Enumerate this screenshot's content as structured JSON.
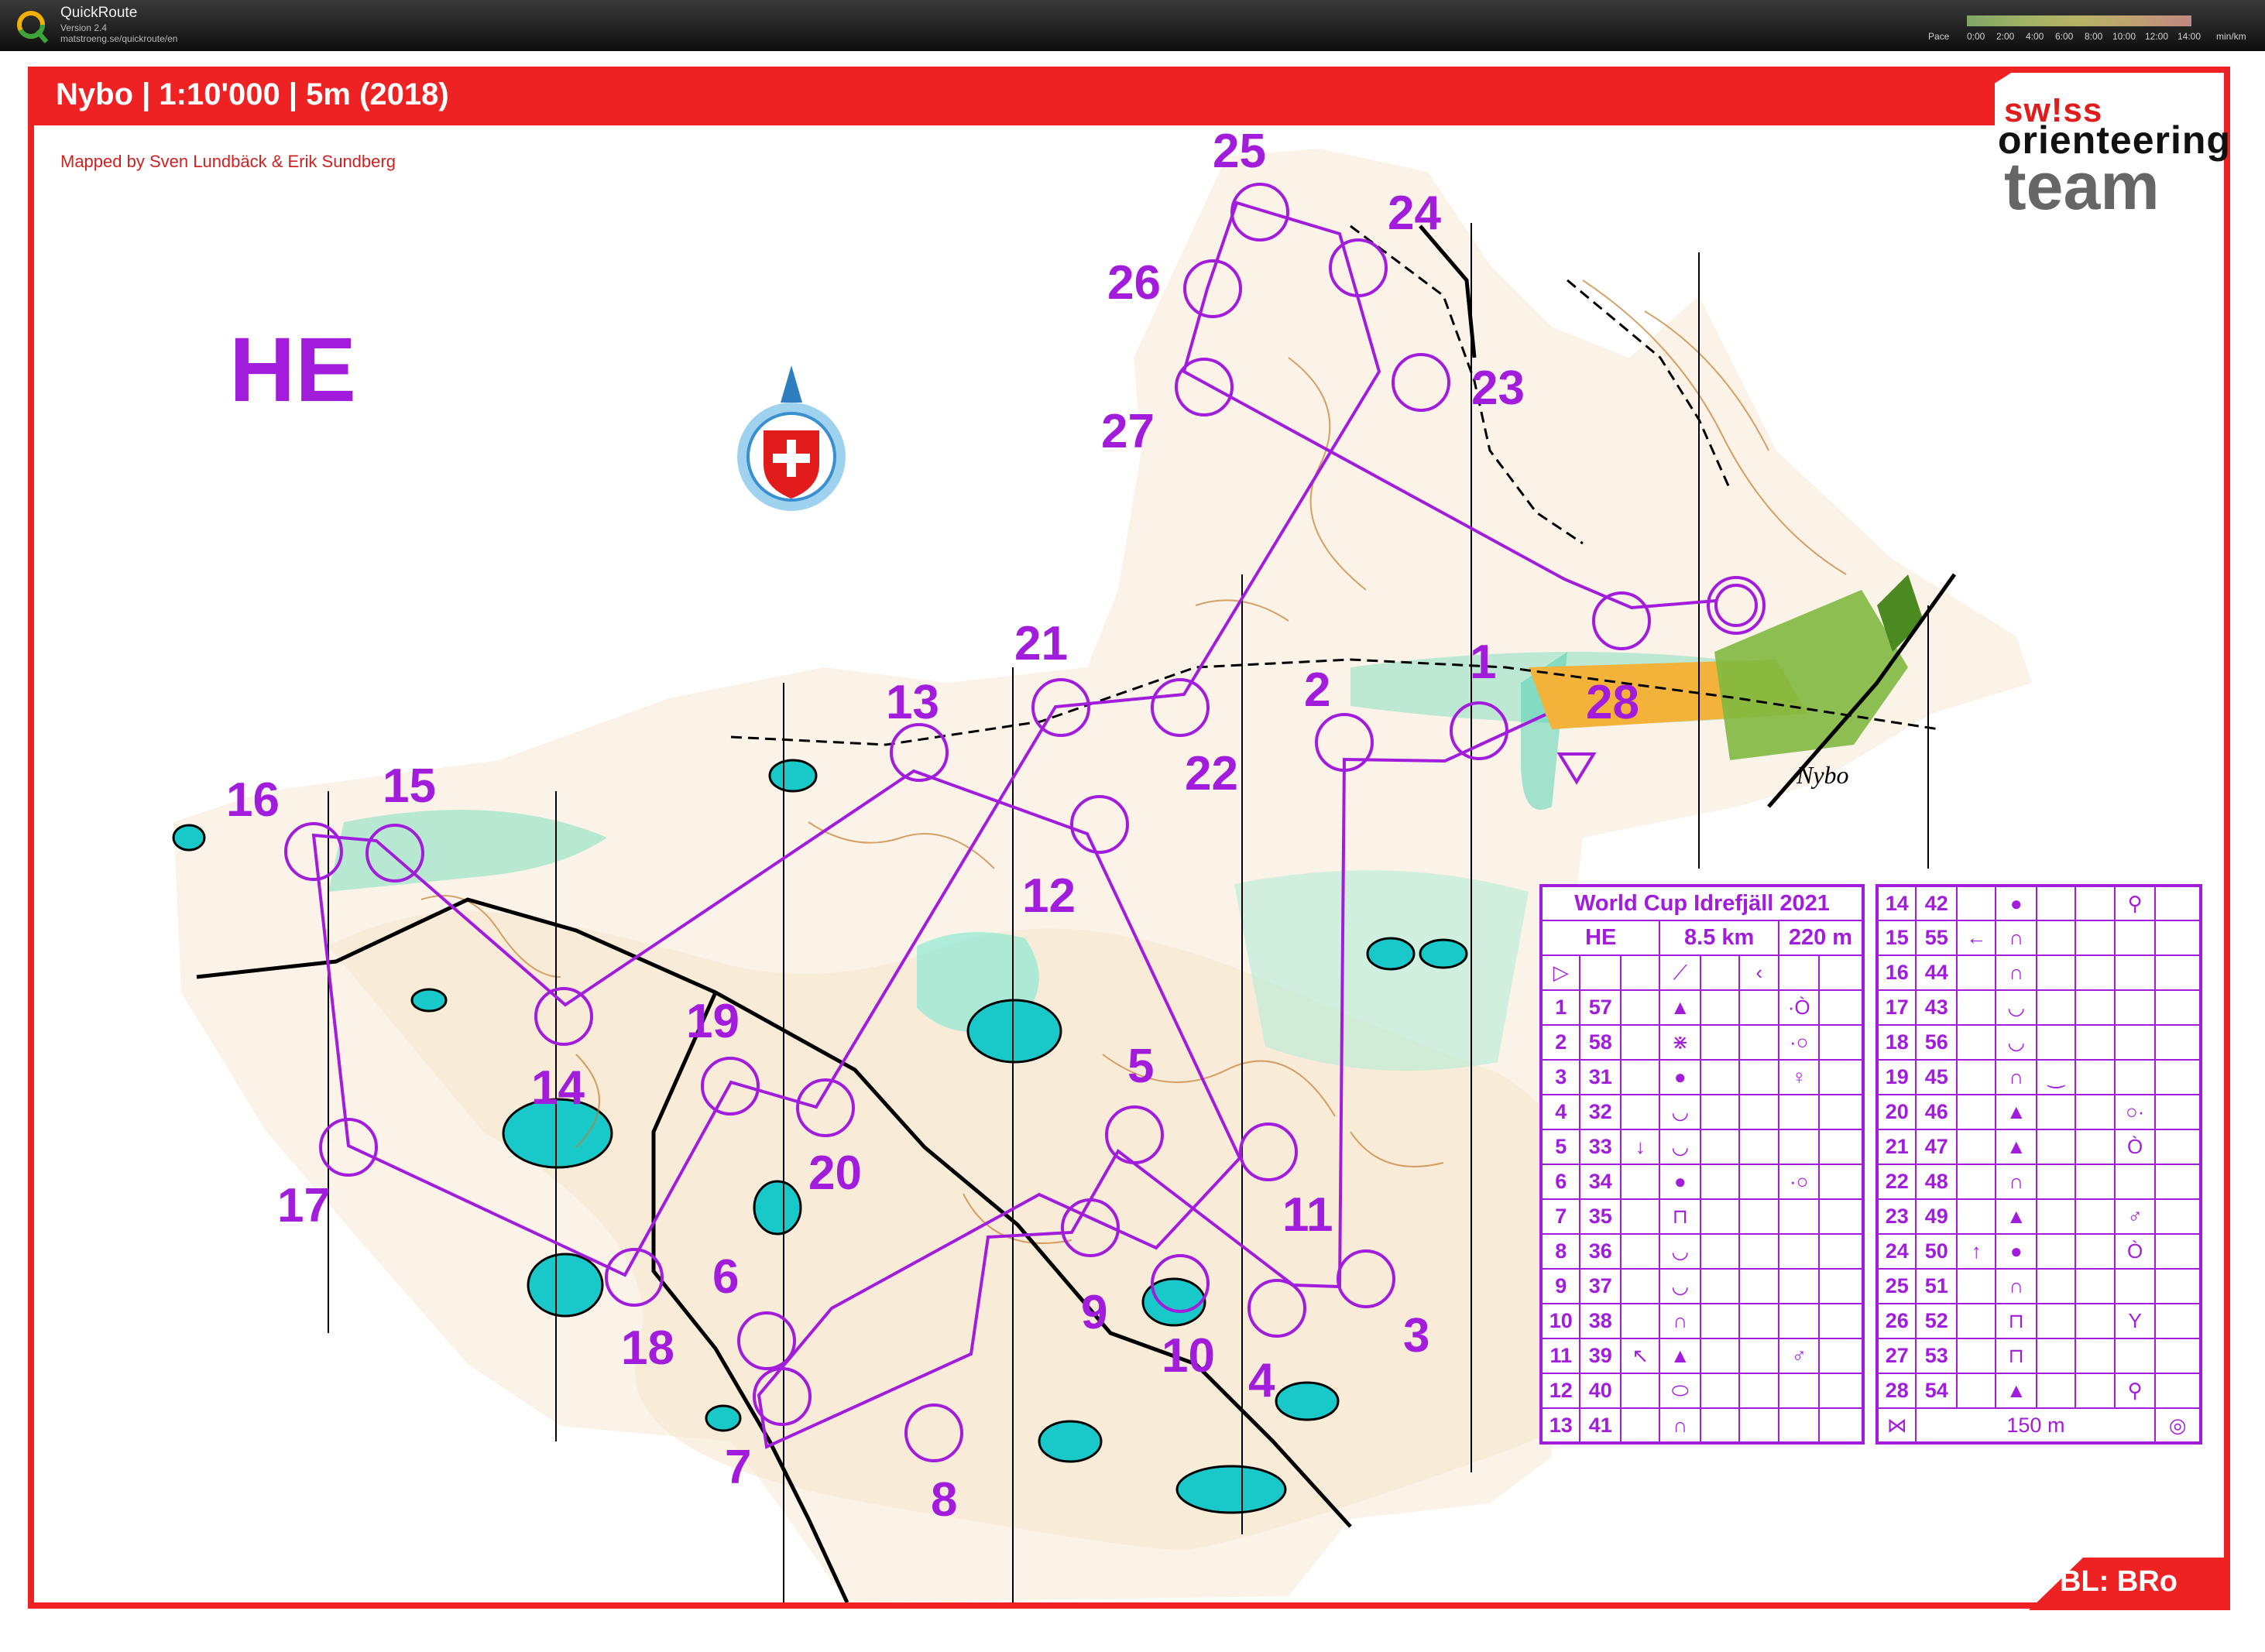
{
  "app": {
    "name": "QuickRoute",
    "version": "Version 2.4",
    "url": "matstroeng.se/quickroute/en",
    "pace_label": "Pace",
    "pace_ticks": [
      "0:00",
      "2:00",
      "4:00",
      "6:00",
      "8:00",
      "10:00",
      "12:00",
      "14:00"
    ],
    "pace_unit": "min/km"
  },
  "map": {
    "title": "Nybo | 1:10'000 | 5m (2018)",
    "mapper": "Mapped by Sven Lundbäck & Erik Sundberg",
    "class": "HE",
    "brand": [
      "sw!ss",
      "orienteering",
      "team"
    ],
    "bl": "BL: BRo",
    "place_label": "Nybo",
    "course_color": "#a21ddb",
    "frame_color": "#ee2222"
  },
  "controls": [
    {
      "num": "1"
    },
    {
      "num": "2"
    },
    {
      "num": "3"
    },
    {
      "num": "4"
    },
    {
      "num": "5"
    },
    {
      "num": "6"
    },
    {
      "num": "7"
    },
    {
      "num": "8"
    },
    {
      "num": "9"
    },
    {
      "num": "10"
    },
    {
      "num": "11"
    },
    {
      "num": "12"
    },
    {
      "num": "13"
    },
    {
      "num": "14"
    },
    {
      "num": "15"
    },
    {
      "num": "16"
    },
    {
      "num": "17"
    },
    {
      "num": "18"
    },
    {
      "num": "19"
    },
    {
      "num": "20"
    },
    {
      "num": "21"
    },
    {
      "num": "22"
    },
    {
      "num": "23"
    },
    {
      "num": "24"
    },
    {
      "num": "25"
    },
    {
      "num": "26"
    },
    {
      "num": "27"
    },
    {
      "num": "28"
    }
  ],
  "description": {
    "event": "World Cup Idrefjäll 2021",
    "class": "HE",
    "length": "8.5 km",
    "climb": "220 m",
    "finish_distance": "150 m",
    "rows": [
      {
        "n": "1",
        "code": "57",
        "dir": "",
        "feat": "▲",
        "detail": "",
        "pos": "·Ò"
      },
      {
        "n": "2",
        "code": "58",
        "dir": "",
        "feat": "⋇",
        "detail": "",
        "pos": "·○"
      },
      {
        "n": "3",
        "code": "31",
        "dir": "",
        "feat": "●",
        "detail": "",
        "pos": "♀"
      },
      {
        "n": "4",
        "code": "32",
        "dir": "",
        "feat": "◡",
        "detail": "",
        "pos": ""
      },
      {
        "n": "5",
        "code": "33",
        "dir": "↓",
        "feat": "◡",
        "detail": "",
        "pos": ""
      },
      {
        "n": "6",
        "code": "34",
        "dir": "",
        "feat": "●",
        "detail": "",
        "pos": "·○"
      },
      {
        "n": "7",
        "code": "35",
        "dir": "",
        "feat": "⊓",
        "detail": "",
        "pos": ""
      },
      {
        "n": "8",
        "code": "36",
        "dir": "",
        "feat": "◡",
        "detail": "",
        "pos": ""
      },
      {
        "n": "9",
        "code": "37",
        "dir": "",
        "feat": "◡",
        "detail": "",
        "pos": ""
      },
      {
        "n": "10",
        "code": "38",
        "dir": "",
        "feat": "∩",
        "detail": "",
        "pos": ""
      },
      {
        "n": "11",
        "code": "39",
        "dir": "↖",
        "feat": "▲",
        "detail": "",
        "pos": "♂"
      },
      {
        "n": "12",
        "code": "40",
        "dir": "",
        "feat": "⬭",
        "detail": "",
        "pos": ""
      },
      {
        "n": "13",
        "code": "41",
        "dir": "",
        "feat": "∩",
        "detail": "",
        "pos": ""
      },
      {
        "n": "14",
        "code": "42",
        "dir": "",
        "feat": "●",
        "detail": "",
        "pos": "⚲"
      },
      {
        "n": "15",
        "code": "55",
        "dir": "←",
        "feat": "∩",
        "detail": "",
        "pos": ""
      },
      {
        "n": "16",
        "code": "44",
        "dir": "",
        "feat": "∩",
        "detail": "",
        "pos": ""
      },
      {
        "n": "17",
        "code": "43",
        "dir": "",
        "feat": "◡",
        "detail": "",
        "pos": ""
      },
      {
        "n": "18",
        "code": "56",
        "dir": "",
        "feat": "◡",
        "detail": "",
        "pos": ""
      },
      {
        "n": "19",
        "code": "45",
        "dir": "",
        "feat": "∩",
        "detail": "‿",
        "pos": ""
      },
      {
        "n": "20",
        "code": "46",
        "dir": "",
        "feat": "▲",
        "detail": "",
        "pos": "○·"
      },
      {
        "n": "21",
        "code": "47",
        "dir": "",
        "feat": "▲",
        "detail": "",
        "pos": "Ò"
      },
      {
        "n": "22",
        "code": "48",
        "dir": "",
        "feat": "∩",
        "detail": "",
        "pos": ""
      },
      {
        "n": "23",
        "code": "49",
        "dir": "",
        "feat": "▲",
        "detail": "",
        "pos": "♂"
      },
      {
        "n": "24",
        "code": "50",
        "dir": "↑",
        "feat": "●",
        "detail": "",
        "pos": "Ò"
      },
      {
        "n": "25",
        "code": "51",
        "dir": "",
        "feat": "∩",
        "detail": "",
        "pos": ""
      },
      {
        "n": "26",
        "code": "52",
        "dir": "",
        "feat": "⊓",
        "detail": "",
        "pos": "Y"
      },
      {
        "n": "27",
        "code": "53",
        "dir": "",
        "feat": "⊓",
        "detail": "",
        "pos": ""
      },
      {
        "n": "28",
        "code": "54",
        "dir": "",
        "feat": "▲",
        "detail": "",
        "pos": "⚲"
      }
    ]
  },
  "icons": {
    "app_logo": "quickroute-q-icon",
    "compass": "swiss-shield-north-arrow-icon"
  }
}
